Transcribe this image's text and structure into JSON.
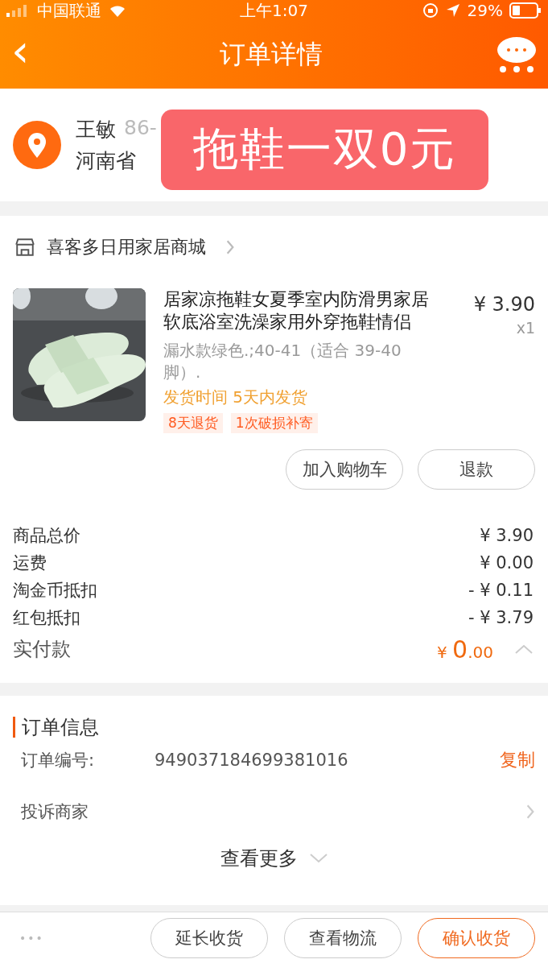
{
  "status_bar": {
    "carrier": "中国联通",
    "time": "上午1:07",
    "battery": "29%"
  },
  "nav": {
    "back": "‹",
    "title": "订单详情"
  },
  "address": {
    "name": "王敏",
    "phone": "86-",
    "province": "河南省"
  },
  "banner": {
    "text": "拖鞋一双0元"
  },
  "shop": {
    "name": "喜客多日用家居商城"
  },
  "product": {
    "kind": "picture",
    "title": "居家凉拖鞋女夏季室内防滑男家居软底浴室洗澡家用外穿拖鞋情侣",
    "price": "¥ 3.90",
    "quantity": "x1",
    "spec": "漏水款绿色.;40-41（适合 39-40 脚）.",
    "shipping": "发货时间  5天内发货",
    "tags": [
      "8天退货",
      "1次破损补寄"
    ],
    "buttons": [
      "加入购物车",
      "退款"
    ]
  },
  "summary": {
    "rows": [
      {
        "label": "商品总价",
        "value": "¥ 3.90"
      },
      {
        "label": "运费",
        "value": "¥ 0.00"
      },
      {
        "label": "淘金币抵扣",
        "value": "- ¥ 0.11"
      },
      {
        "label": "红包抵扣",
        "value": "- ¥ 3.79"
      }
    ],
    "paid": {
      "label": "实付款",
      "currency": "¥",
      "integer": "0",
      "decimal": ".00",
      "expanded": true
    }
  },
  "order_info": {
    "title": "订单信息",
    "number_label": "订单编号:",
    "number": "949037184699381016",
    "copy": "复制",
    "complaint": "投诉商家",
    "more": "查看更多"
  },
  "bottom_bar": {
    "more": "•••",
    "buttons": [
      {
        "label": "延长收货",
        "primary": false
      },
      {
        "label": "查看物流",
        "primary": false
      },
      {
        "label": "确认收货",
        "primary": true
      }
    ]
  }
}
